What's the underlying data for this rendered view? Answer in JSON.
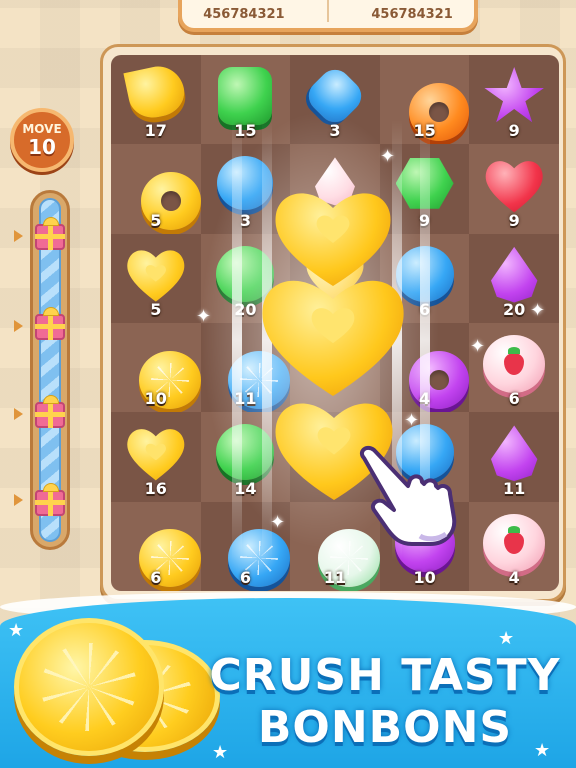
{
  "scores": {
    "left": "456784321",
    "right": "456784321"
  },
  "moves": {
    "label": "MOVE",
    "value": "10"
  },
  "board": {
    "rows": [
      [
        {
          "candy": "yellow-banana",
          "count": "17"
        },
        {
          "candy": "green-square",
          "count": "15"
        },
        {
          "candy": "blue-diamond",
          "count": "3"
        },
        {
          "candy": "orange-ring",
          "count": "15"
        },
        {
          "candy": "purple-star",
          "count": "9"
        }
      ],
      [
        {
          "candy": "yellow-ring",
          "count": "5"
        },
        {
          "candy": "blue-lollipop",
          "count": "3"
        },
        {
          "candy": "pink-drop",
          "count": ""
        },
        {
          "candy": "green-hex",
          "count": "9"
        },
        {
          "candy": "red-heart",
          "count": "9"
        }
      ],
      [
        {
          "candy": "yellow-heart",
          "count": "5"
        },
        {
          "candy": "green-round",
          "count": "20"
        },
        {
          "candy": "yellow-heart",
          "count": ""
        },
        {
          "candy": "blue-round",
          "count": "6"
        },
        {
          "candy": "purple-drop",
          "count": "20"
        }
      ],
      [
        {
          "candy": "yellow-slice",
          "count": "10"
        },
        {
          "candy": "blue-slice",
          "count": "11"
        },
        {
          "candy": "yellow-heart",
          "count": ""
        },
        {
          "candy": "purple-ring",
          "count": "4"
        },
        {
          "candy": "pink-strawberry",
          "count": "6"
        }
      ],
      [
        {
          "candy": "yellow-heart",
          "count": "16"
        },
        {
          "candy": "green-round",
          "count": "14"
        },
        {
          "candy": "yellow-heart",
          "count": ""
        },
        {
          "candy": "blue-round",
          "count": ""
        },
        {
          "candy": "purple-drop",
          "count": "11"
        }
      ],
      [
        {
          "candy": "yellow-slice",
          "count": "6"
        },
        {
          "candy": "blue-slice",
          "count": "6"
        },
        {
          "candy": "white-slice",
          "count": "11"
        },
        {
          "candy": "purple-round",
          "count": "10"
        },
        {
          "candy": "pink-strawberry",
          "count": "4"
        }
      ]
    ]
  },
  "banner": {
    "line1": "CRUSH TASTY",
    "line2": "BONBONS"
  },
  "colors": {
    "board_frame": "#cd9757",
    "move_badge": "#d76b2a",
    "water": "#1ea5e6",
    "candy_yellow": "#ffcb1f"
  }
}
